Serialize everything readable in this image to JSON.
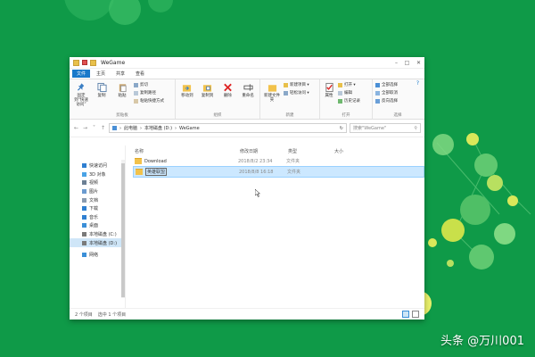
{
  "window": {
    "title": "WeGame",
    "controls": [
      "–",
      "□",
      "✕"
    ],
    "help": "?"
  },
  "ribbon_tabs": [
    "文件",
    "主页",
    "共享",
    "查看"
  ],
  "ribbon": {
    "clipboard": {
      "label": "剪贴板",
      "pin": "固定到“快速访问”",
      "copy": "复制",
      "paste": "粘贴",
      "cut": "剪切",
      "copy_path": "复制路径",
      "paste_shortcut": "粘贴快捷方式"
    },
    "organize": {
      "label": "组织",
      "move_to": "移动到",
      "copy_to": "复制到",
      "delete": "删除",
      "rename": "重命名"
    },
    "new": {
      "label": "新建",
      "new_folder": "新建文件夹",
      "new_item": "新建项目 ▾",
      "easy_access": "轻松访问 ▾"
    },
    "open": {
      "label": "打开",
      "properties": "属性",
      "open": "打开 ▾",
      "edit": "编辑",
      "history": "历史记录"
    },
    "select": {
      "label": "选择",
      "select_all": "全部选择",
      "select_none": "全部取消",
      "invert": "反向选择"
    }
  },
  "address": {
    "breadcrumb": [
      "此电脑",
      "本地磁盘 (D:)",
      "WeGame"
    ],
    "search_placeholder": "搜索\"WeGame\""
  },
  "columns": [
    "名称",
    "修改日期",
    "类型",
    "大小"
  ],
  "files": [
    {
      "name": "Download",
      "date": "2018/8/2 23:34",
      "type": "文件夹",
      "size": ""
    },
    {
      "name": "英雄联盟",
      "date": "2018/8/8 16:18",
      "type": "文件夹",
      "size": ""
    }
  ],
  "nav": [
    {
      "label": "快速访问",
      "icon": "star-icon",
      "color": "#2f7fd1"
    },
    {
      "label": "3D 对象",
      "icon": "cube-icon",
      "color": "#4aa3e6"
    },
    {
      "label": "视频",
      "icon": "video-icon",
      "color": "#6b7f94"
    },
    {
      "label": "图片",
      "icon": "picture-icon",
      "color": "#6b9bd0"
    },
    {
      "label": "文档",
      "icon": "document-icon",
      "color": "#8a9bb0"
    },
    {
      "label": "下载",
      "icon": "download-icon",
      "color": "#2f7fd1"
    },
    {
      "label": "音乐",
      "icon": "music-icon",
      "color": "#2f7fd1"
    },
    {
      "label": "桌面",
      "icon": "desktop-icon",
      "color": "#3b8fd8"
    },
    {
      "label": "本地磁盘 (C:)",
      "icon": "drive-icon",
      "color": "#7a7a7a"
    },
    {
      "label": "本地磁盘 (D:)",
      "icon": "drive-icon",
      "color": "#7a7a7a"
    },
    {
      "label": "网络",
      "icon": "network-icon",
      "color": "#3b8fd8"
    }
  ],
  "status": {
    "count": "2 个项目",
    "selected": "选中 1 个项目"
  },
  "watermark": "头条 @万川001",
  "colors": {
    "background": "#0f9a48",
    "accent": "#1979ca",
    "selection": "#cce8ff"
  }
}
